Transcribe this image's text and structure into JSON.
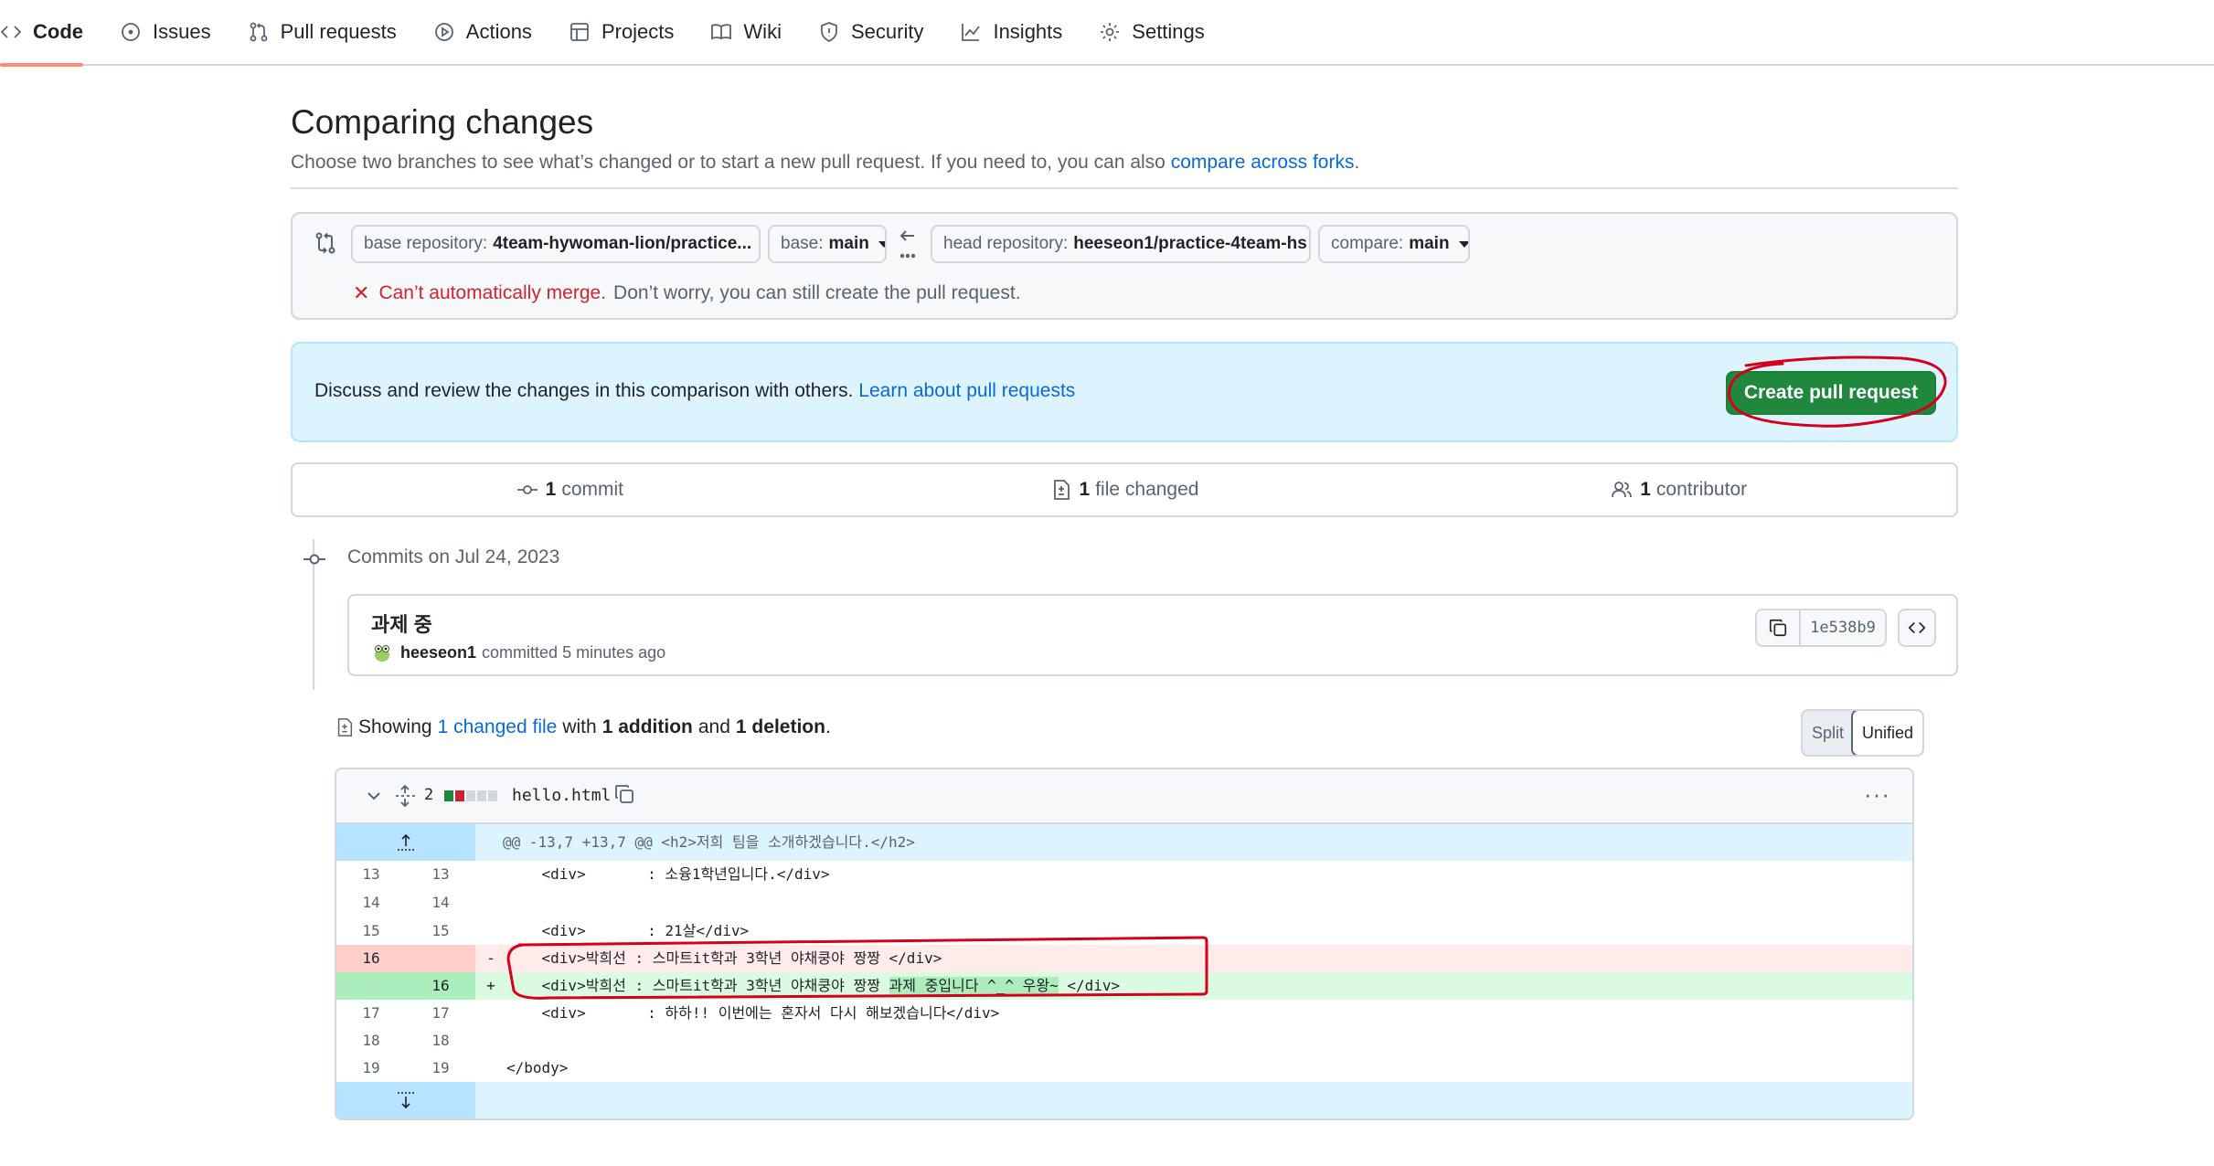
{
  "nav": {
    "items": [
      {
        "label": "Code",
        "icon": "code-icon",
        "active": true
      },
      {
        "label": "Issues",
        "icon": "issue-icon"
      },
      {
        "label": "Pull requests",
        "icon": "pull-request-icon"
      },
      {
        "label": "Actions",
        "icon": "play-icon"
      },
      {
        "label": "Projects",
        "icon": "table-icon"
      },
      {
        "label": "Wiki",
        "icon": "book-icon"
      },
      {
        "label": "Security",
        "icon": "shield-icon"
      },
      {
        "label": "Insights",
        "icon": "graph-icon"
      },
      {
        "label": "Settings",
        "icon": "gear-icon"
      }
    ]
  },
  "header": {
    "title": "Comparing changes",
    "subtitle": "Choose two branches to see what’s changed or to start a new pull request. If you need to, you can also",
    "subtitle_link": "compare across forks",
    "subtitle_end": "."
  },
  "range": {
    "base_repo_label": "base repository:",
    "base_repo_value": "4team-hywoman-lion/practice...",
    "base_label": "base:",
    "base_value": "main",
    "head_repo_label": "head repository:",
    "head_repo_value": "heeseon1/practice-4team-hs",
    "compare_label": "compare:",
    "compare_value": "main",
    "merge_bad": "Can’t automatically merge.",
    "merge_note": "Don’t worry, you can still create the pull request."
  },
  "discuss": {
    "text": "Discuss and review the changes in this comparison with others.",
    "link": "Learn about pull requests",
    "button": "Create pull request"
  },
  "summary": {
    "commits_count": "1",
    "commits_label": "commit",
    "files_count": "1",
    "files_label": "file changed",
    "contributors_count": "1",
    "contributors_label": "contributor"
  },
  "commits": {
    "date_heading": "Commits on Jul 24, 2023",
    "title": "과제 중",
    "author": "heeseon1",
    "meta": "committed 5 minutes ago",
    "sha": "1e538b9"
  },
  "diffstat": {
    "prefix": "Showing",
    "files_link": "1 changed file",
    "with": "with",
    "additions": "1 addition",
    "and": "and",
    "deletions": "1 deletion",
    "end": ".",
    "split": "Split",
    "unified": "Unified"
  },
  "file": {
    "change_count": "2",
    "name": "hello.html",
    "hunk_header": "@@ -13,7 +13,7 @@ <h2>저희 팀을 소개하겠습니다.</h2>",
    "lines": [
      {
        "old": "13",
        "new": "13",
        "sign": "",
        "code": "    <div>       : 소융1학년입니다.</div>",
        "type": "ctx"
      },
      {
        "old": "14",
        "new": "14",
        "sign": "",
        "code": "",
        "type": "ctx"
      },
      {
        "old": "15",
        "new": "15",
        "sign": "",
        "code": "    <div>       : 21살</div>",
        "type": "ctx"
      },
      {
        "old": "16",
        "new": "",
        "sign": "-",
        "code": "    <div>박희선 : 스마트it학과 3학년 야채쿵야 짱짱 </div>",
        "type": "del"
      },
      {
        "old": "",
        "new": "16",
        "sign": "+",
        "code_before": "    <div>박희선 : 스마트it학과 3학년 야채쿵야 짱짱 ",
        "code_hl": "과제 중입니다 ^_^ 우왕~",
        "code_after": " </div>",
        "type": "add"
      },
      {
        "old": "17",
        "new": "17",
        "sign": "",
        "code": "    <div>       : 하하!! 이번에는 혼자서 다시 해보겠습니다</div>",
        "type": "ctx"
      },
      {
        "old": "18",
        "new": "18",
        "sign": "",
        "code": "",
        "type": "ctx"
      },
      {
        "old": "19",
        "new": "19",
        "sign": "",
        "code": "</body>",
        "type": "ctx"
      }
    ]
  },
  "colors": {
    "accent_green": "#1f883d",
    "link_blue": "#0969da",
    "danger_red": "#d1242f",
    "annotation_red": "#d6001c"
  }
}
